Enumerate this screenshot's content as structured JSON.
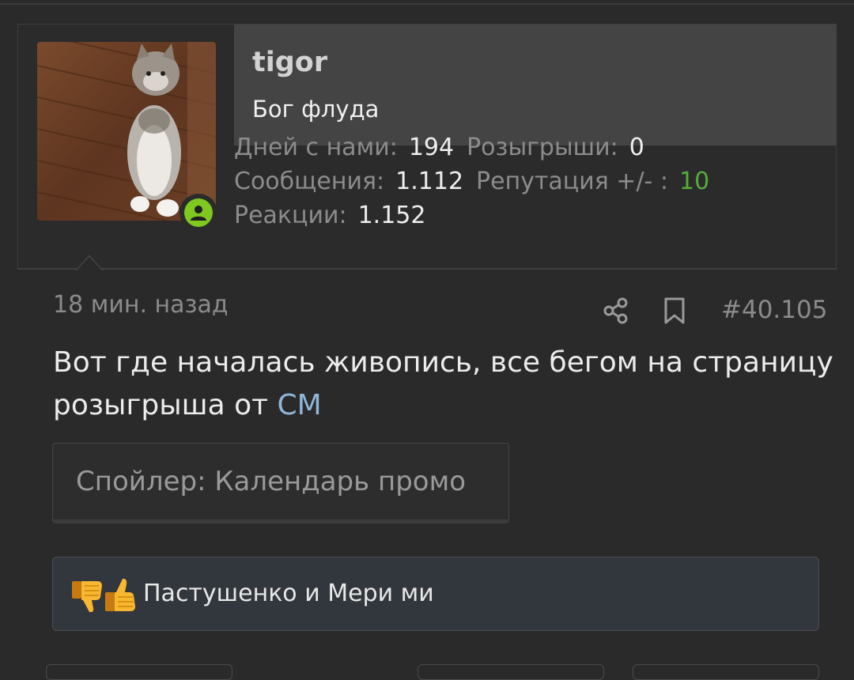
{
  "user": {
    "name": "tigor",
    "title": "Бог флуда",
    "avatar_icon": "cat-photo-avatar",
    "online_icon": "user-online-icon"
  },
  "stats": {
    "days_label": "Дней с нами:",
    "days_value": "194",
    "giveaways_label": "Розыгрыши:",
    "giveaways_value": "0",
    "messages_label": "Сообщения:",
    "messages_value": "1.112",
    "reputation_label": "Репутация +/- :",
    "reputation_value": "10",
    "reactions_label": "Реакции:",
    "reactions_value": "1.152"
  },
  "post": {
    "time": "18 мин. назад",
    "number": "#40.105",
    "text_main": "Вот где началась живопись, все бегом на страницу розыгрыша от ",
    "text_link": "СМ"
  },
  "spoiler": {
    "label": "Спойлер: Календарь промо"
  },
  "reactions": {
    "names": "Пастушенко и Мери ми",
    "emoji_icons": [
      "thumbs-down-icon",
      "thumbs-up-icon"
    ]
  },
  "colors": {
    "background": "#2a2a2a",
    "header_bg": "#444444",
    "reputation": "#55ad3a",
    "link": "#8fb7d9",
    "online": "#7ec820"
  }
}
